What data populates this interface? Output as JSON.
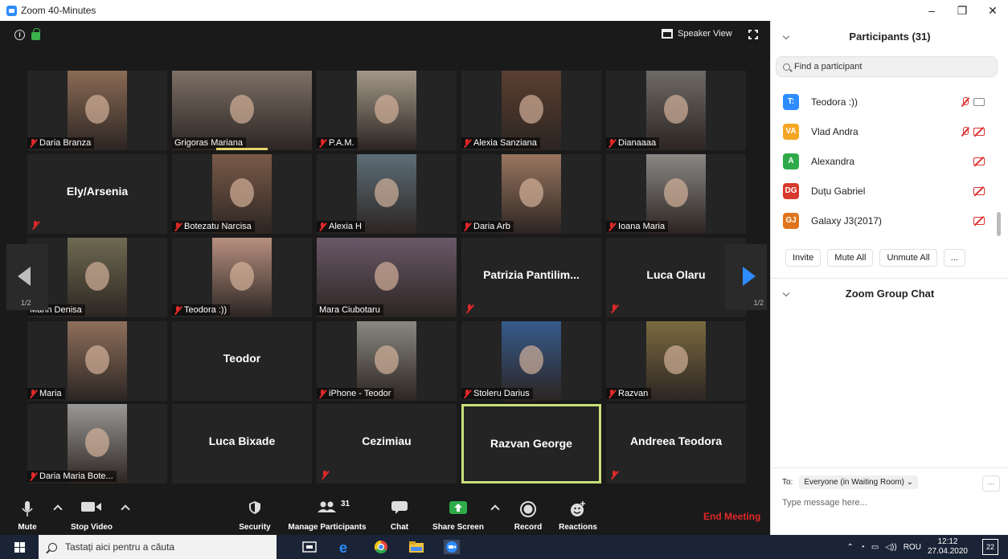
{
  "window": {
    "title": "Zoom 40-Minutes",
    "controls": [
      "–",
      "❐",
      "✕"
    ]
  },
  "stage": {
    "speaker_view_label": "Speaker View",
    "page_left": "1/2",
    "page_right": "1/2"
  },
  "tiles": [
    {
      "name": "Daria Branza",
      "muted": true,
      "video": true,
      "vc": "#8a6b55"
    },
    {
      "name": "Grigoras Mariana",
      "muted": false,
      "video": true,
      "vc": "#7d7066",
      "wide": true
    },
    {
      "name": "P.A.M.",
      "muted": true,
      "video": true,
      "vc": "#a39888"
    },
    {
      "name": "Alexia Sanziana",
      "muted": true,
      "video": true,
      "vc": "#5a3f30"
    },
    {
      "name": "Dianaaaa",
      "muted": true,
      "video": true,
      "vc": "#6e6a66"
    },
    {
      "name": "Ely/Arsenia",
      "muted": true,
      "video": false
    },
    {
      "name": "Botezatu Narcisa",
      "muted": true,
      "video": true,
      "vc": "#7a5a48"
    },
    {
      "name": "Alexia H",
      "muted": true,
      "video": true,
      "vc": "#5d6e78"
    },
    {
      "name": "Daria Arb",
      "muted": true,
      "video": true,
      "vc": "#9a7660"
    },
    {
      "name": "Ioana Maria",
      "muted": true,
      "video": true,
      "vc": "#8a8884"
    },
    {
      "name": "Marin Denisa",
      "muted": false,
      "video": true,
      "vc": "#6f6a52"
    },
    {
      "name": "Teodora :))",
      "muted": true,
      "video": true,
      "vc": "#b89080"
    },
    {
      "name": "Mara Ciubotaru",
      "muted": false,
      "video": true,
      "vc": "#6a5868",
      "wide": true
    },
    {
      "name": "Patrizia  Pantilim...",
      "muted": true,
      "video": false
    },
    {
      "name": "Luca Olaru",
      "muted": true,
      "video": false
    },
    {
      "name": "Maria",
      "muted": true,
      "video": true,
      "vc": "#8e6f5c"
    },
    {
      "name": "Teodor",
      "muted": false,
      "video": false
    },
    {
      "name": "iPhone - Teodor",
      "muted": true,
      "video": true,
      "vc": "#8a8780"
    },
    {
      "name": "Stoleru Darius",
      "muted": true,
      "video": true,
      "vc": "#355a8c"
    },
    {
      "name": "Razvan",
      "muted": true,
      "video": true,
      "vc": "#7a6a40"
    },
    {
      "name": "Daria Maria Bote...",
      "muted": true,
      "video": true,
      "vc": "#9a9896"
    },
    {
      "name": "Luca Bixade",
      "muted": false,
      "video": false
    },
    {
      "name": "Cezimiau",
      "muted": true,
      "video": false
    },
    {
      "name": "Razvan George",
      "muted": false,
      "video": false,
      "active": true
    },
    {
      "name": "Andreea Teodora",
      "muted": true,
      "video": false
    }
  ],
  "toolbar": {
    "mute": "Mute",
    "stop_video": "Stop Video",
    "security": "Security",
    "manage_participants": "Manage Participants",
    "participant_count": "31",
    "chat": "Chat",
    "share_screen": "Share Screen",
    "record": "Record",
    "reactions": "Reactions",
    "end_meeting": "End Meeting"
  },
  "participants_panel": {
    "title": "Participants (31)",
    "search_placeholder": "Find a participant",
    "list": [
      {
        "initials": "T:",
        "name": "Teodora :))",
        "color": "#2d8cff",
        "mic_muted": true,
        "cam_off": false
      },
      {
        "initials": "VA",
        "name": "Vlad Andra",
        "color": "#f5a623",
        "mic_muted": true,
        "cam_off": true
      },
      {
        "initials": "A",
        "name": "Alexandra",
        "color": "#2eaa4a",
        "mic_muted": false,
        "cam_off": true
      },
      {
        "initials": "DG",
        "name": "Duțu Gabriel",
        "color": "#d9382e",
        "mic_muted": false,
        "cam_off": true
      },
      {
        "initials": "GJ",
        "name": "Galaxy J3(2017)",
        "color": "#e0741c",
        "mic_muted": false,
        "cam_off": true
      }
    ],
    "buttons": {
      "invite": "Invite",
      "mute_all": "Mute All",
      "unmute_all": "Unmute All",
      "more": "..."
    }
  },
  "chat_panel": {
    "title": "Zoom Group Chat",
    "to_label": "To:",
    "to_value": "Everyone (in Waiting Room) ⌄",
    "more": "···",
    "input_placeholder": "Type message here..."
  },
  "taskbar": {
    "search_placeholder": "Tastați aici pentru a căuta",
    "language": "ROU",
    "time": "12:12",
    "date": "27.04.2020",
    "notifications": "22"
  }
}
